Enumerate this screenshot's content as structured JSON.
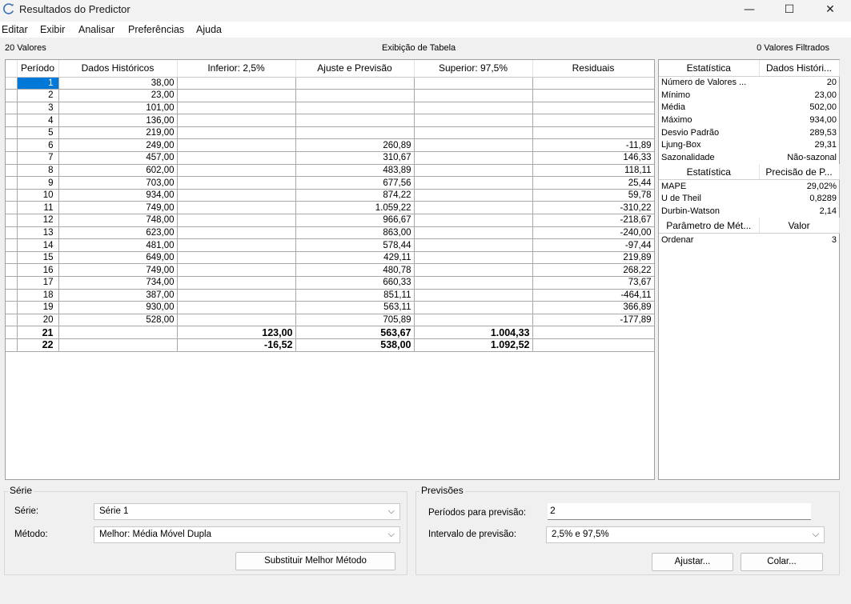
{
  "window": {
    "title": "Resultados do Predictor",
    "icons": [
      "predictor-logo-icon",
      "minimize-icon",
      "maximize-icon",
      "close-icon"
    ],
    "controls": {
      "minimize": "—",
      "maximize": "☐",
      "close": "✕"
    }
  },
  "menu": [
    "Editar",
    "Exibir",
    "Analisar",
    "Preferências",
    "Ajuda"
  ],
  "info": {
    "left": "20 Valores",
    "center": "Exibição de Tabela",
    "right": "0 Valores Filtrados"
  },
  "table": {
    "headers": [
      "Período",
      "Dados Históricos",
      "Inferior: 2,5%",
      "Ajuste e Previsão",
      "Superior: 97,5%",
      "Residuais"
    ],
    "rows": [
      [
        "1",
        "38,00",
        "",
        "",
        "",
        ""
      ],
      [
        "2",
        "23,00",
        "",
        "",
        "",
        ""
      ],
      [
        "3",
        "101,00",
        "",
        "",
        "",
        ""
      ],
      [
        "4",
        "136,00",
        "",
        "",
        "",
        ""
      ],
      [
        "5",
        "219,00",
        "",
        "",
        "",
        ""
      ],
      [
        "6",
        "249,00",
        "",
        "260,89",
        "",
        "-11,89"
      ],
      [
        "7",
        "457,00",
        "",
        "310,67",
        "",
        "146,33"
      ],
      [
        "8",
        "602,00",
        "",
        "483,89",
        "",
        "118,11"
      ],
      [
        "9",
        "703,00",
        "",
        "677,56",
        "",
        "25,44"
      ],
      [
        "10",
        "934,00",
        "",
        "874,22",
        "",
        "59,78"
      ],
      [
        "11",
        "749,00",
        "",
        "1.059,22",
        "",
        "-310,22"
      ],
      [
        "12",
        "748,00",
        "",
        "966,67",
        "",
        "-218,67"
      ],
      [
        "13",
        "623,00",
        "",
        "863,00",
        "",
        "-240,00"
      ],
      [
        "14",
        "481,00",
        "",
        "578,44",
        "",
        "-97,44"
      ],
      [
        "15",
        "649,00",
        "",
        "429,11",
        "",
        "219,89"
      ],
      [
        "16",
        "749,00",
        "",
        "480,78",
        "",
        "268,22"
      ],
      [
        "17",
        "734,00",
        "",
        "660,33",
        "",
        "73,67"
      ],
      [
        "18",
        "387,00",
        "",
        "851,11",
        "",
        "-464,11"
      ],
      [
        "19",
        "930,00",
        "",
        "563,11",
        "",
        "366,89"
      ],
      [
        "20",
        "528,00",
        "",
        "705,89",
        "",
        "-177,89"
      ],
      [
        "21",
        "",
        "123,00",
        "563,67",
        "1.004,33",
        ""
      ],
      [
        "22",
        "",
        "-16,52",
        "538,00",
        "1.092,52",
        ""
      ]
    ],
    "forecast_rows": [
      20,
      21
    ],
    "selected_cell": "1"
  },
  "stats": {
    "sections": [
      {
        "headers": [
          "Estatística",
          "Dados Históri..."
        ],
        "rows": [
          [
            "Número de Valores ...",
            "20"
          ],
          [
            "Mínimo",
            "23,00"
          ],
          [
            "Média",
            "502,00"
          ],
          [
            "Máximo",
            "934,00"
          ],
          [
            "Desvio Padrão",
            "289,53"
          ],
          [
            "Ljung-Box",
            "29,31"
          ],
          [
            "Sazonalidade",
            "Não-sazonal"
          ]
        ]
      },
      {
        "headers": [
          "Estatística",
          "Precisão de P..."
        ],
        "rows": [
          [
            "MAPE",
            "29,02%"
          ],
          [
            "U de Theil",
            "0,8289"
          ],
          [
            "Durbin-Watson",
            "2,14"
          ]
        ]
      },
      {
        "headers": [
          "Parâmetro de Mét...",
          "Valor"
        ],
        "rows": [
          [
            "Ordenar",
            "3"
          ]
        ]
      }
    ]
  },
  "serie": {
    "group_title": "Série",
    "serie_label": "Série:",
    "serie_value": "Série 1",
    "metodo_label": "Método:",
    "metodo_value": "Melhor: Média Móvel Dupla",
    "replace_button": "Substituir Melhor Método"
  },
  "previsoes": {
    "group_title": "Previsões",
    "periods_label": "Períodos para previsão:",
    "periods_value": "2",
    "interval_label": "Intervalo de previsão:",
    "interval_value": "2,5% e 97,5%",
    "adjust_button": "Ajustar...",
    "paste_button": "Colar..."
  }
}
